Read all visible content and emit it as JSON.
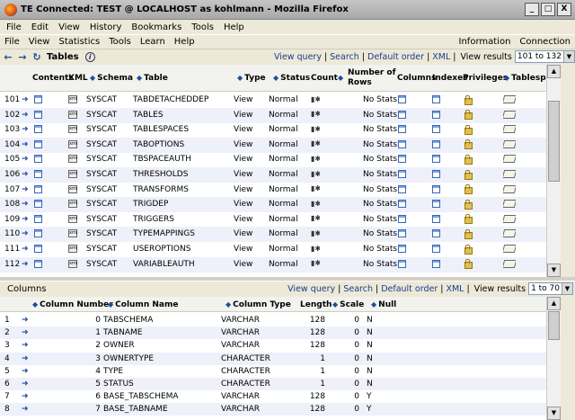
{
  "window": {
    "title": "TE Connected: TEST @ LOCALHOST as kohlmann - Mozilla Firefox",
    "buttons": [
      "_",
      "□",
      "X"
    ]
  },
  "browser_menu": [
    "File",
    "Edit",
    "View",
    "History",
    "Bookmarks",
    "Tools",
    "Help"
  ],
  "app_menu": {
    "left": [
      "File",
      "View",
      "Statistics",
      "Tools",
      "Learn",
      "Help"
    ],
    "right": [
      "Information",
      "Connection"
    ]
  },
  "tables_panel": {
    "title": "Tables",
    "links": [
      "View query",
      "Search",
      "Default order",
      "XML"
    ],
    "view_results_label": "View results",
    "range": "101 to 132",
    "headers": {
      "contents": "Contents",
      "xml": "XML",
      "schema": "Schema",
      "table": "Table",
      "type": "Type",
      "status": "Status",
      "count": "Count",
      "rows_1": "Number of",
      "rows_2": "Rows",
      "columns": "Columns",
      "indexes": "Indexes",
      "privileges": "Privileges",
      "tablespace": "Tablespace"
    },
    "rows": [
      {
        "n": "101",
        "schema": "SYSCAT",
        "table": "TABDETACHEDDEP",
        "type": "View",
        "status": "Normal",
        "rows": "No Stats"
      },
      {
        "n": "102",
        "schema": "SYSCAT",
        "table": "TABLES",
        "type": "View",
        "status": "Normal",
        "rows": "No Stats"
      },
      {
        "n": "103",
        "schema": "SYSCAT",
        "table": "TABLESPACES",
        "type": "View",
        "status": "Normal",
        "rows": "No Stats"
      },
      {
        "n": "104",
        "schema": "SYSCAT",
        "table": "TABOPTIONS",
        "type": "View",
        "status": "Normal",
        "rows": "No Stats"
      },
      {
        "n": "105",
        "schema": "SYSCAT",
        "table": "TBSPACEAUTH",
        "type": "View",
        "status": "Normal",
        "rows": "No Stats"
      },
      {
        "n": "106",
        "schema": "SYSCAT",
        "table": "THRESHOLDS",
        "type": "View",
        "status": "Normal",
        "rows": "No Stats"
      },
      {
        "n": "107",
        "schema": "SYSCAT",
        "table": "TRANSFORMS",
        "type": "View",
        "status": "Normal",
        "rows": "No Stats"
      },
      {
        "n": "108",
        "schema": "SYSCAT",
        "table": "TRIGDEP",
        "type": "View",
        "status": "Normal",
        "rows": "No Stats"
      },
      {
        "n": "109",
        "schema": "SYSCAT",
        "table": "TRIGGERS",
        "type": "View",
        "status": "Normal",
        "rows": "No Stats"
      },
      {
        "n": "110",
        "schema": "SYSCAT",
        "table": "TYPEMAPPINGS",
        "type": "View",
        "status": "Normal",
        "rows": "No Stats"
      },
      {
        "n": "111",
        "schema": "SYSCAT",
        "table": "USEROPTIONS",
        "type": "View",
        "status": "Normal",
        "rows": "No Stats"
      },
      {
        "n": "112",
        "schema": "SYSCAT",
        "table": "VARIABLEAUTH",
        "type": "View",
        "status": "Normal",
        "rows": "No Stats"
      }
    ]
  },
  "columns_panel": {
    "title": "Columns",
    "links": [
      "View query",
      "Search",
      "Default order",
      "XML"
    ],
    "view_results_label": "View results",
    "range": "1 to 70",
    "headers": {
      "number": "Column Number",
      "name": "Column Name",
      "type": "Column Type",
      "length": "Length",
      "scale": "Scale",
      "null": "Null"
    },
    "rows": [
      {
        "n": "1",
        "num": "0",
        "name": "TABSCHEMA",
        "type": "VARCHAR",
        "length": "128",
        "scale": "0",
        "null": "N"
      },
      {
        "n": "2",
        "num": "1",
        "name": "TABNAME",
        "type": "VARCHAR",
        "length": "128",
        "scale": "0",
        "null": "N"
      },
      {
        "n": "3",
        "num": "2",
        "name": "OWNER",
        "type": "VARCHAR",
        "length": "128",
        "scale": "0",
        "null": "N"
      },
      {
        "n": "4",
        "num": "3",
        "name": "OWNERTYPE",
        "type": "CHARACTER",
        "length": "1",
        "scale": "0",
        "null": "N"
      },
      {
        "n": "5",
        "num": "4",
        "name": "TYPE",
        "type": "CHARACTER",
        "length": "1",
        "scale": "0",
        "null": "N"
      },
      {
        "n": "6",
        "num": "5",
        "name": "STATUS",
        "type": "CHARACTER",
        "length": "1",
        "scale": "0",
        "null": "N"
      },
      {
        "n": "7",
        "num": "6",
        "name": "BASE_TABSCHEMA",
        "type": "VARCHAR",
        "length": "128",
        "scale": "0",
        "null": "Y"
      },
      {
        "n": "8",
        "num": "7",
        "name": "BASE_TABNAME",
        "type": "VARCHAR",
        "length": "128",
        "scale": "0",
        "null": "Y"
      }
    ]
  },
  "colors": {
    "link": "#1a3c8a",
    "row_alt": "#eef0fa",
    "chrome": "#ece9d8"
  }
}
